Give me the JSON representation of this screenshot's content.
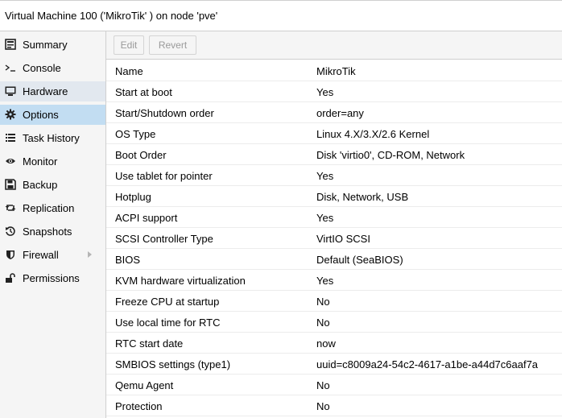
{
  "window": {
    "title": "Virtual Machine 100 ('MikroTik' ) on node 'pve'"
  },
  "sidebar": {
    "items": [
      {
        "label": "Summary",
        "icon": "summary-icon"
      },
      {
        "label": "Console",
        "icon": "console-icon"
      },
      {
        "label": "Hardware",
        "icon": "monitor-icon",
        "state": "hover"
      },
      {
        "label": "Options",
        "icon": "gear-icon",
        "state": "selected"
      },
      {
        "label": "Task History",
        "icon": "list-icon"
      },
      {
        "label": "Monitor",
        "icon": "eye-icon"
      },
      {
        "label": "Backup",
        "icon": "floppy-icon"
      },
      {
        "label": "Replication",
        "icon": "retweet-icon"
      },
      {
        "label": "Snapshots",
        "icon": "history-icon"
      },
      {
        "label": "Firewall",
        "icon": "shield-icon",
        "has_submenu": true
      },
      {
        "label": "Permissions",
        "icon": "unlock-icon"
      }
    ]
  },
  "toolbar": {
    "edit_label": "Edit",
    "revert_label": "Revert"
  },
  "options": [
    {
      "key": "Name",
      "value": "MikroTik"
    },
    {
      "key": "Start at boot",
      "value": "Yes"
    },
    {
      "key": "Start/Shutdown order",
      "value": "order=any"
    },
    {
      "key": "OS Type",
      "value": "Linux 4.X/3.X/2.6 Kernel"
    },
    {
      "key": "Boot Order",
      "value": "Disk 'virtio0', CD-ROM, Network"
    },
    {
      "key": "Use tablet for pointer",
      "value": "Yes"
    },
    {
      "key": "Hotplug",
      "value": "Disk, Network, USB"
    },
    {
      "key": "ACPI support",
      "value": "Yes"
    },
    {
      "key": "SCSI Controller Type",
      "value": "VirtIO SCSI"
    },
    {
      "key": "BIOS",
      "value": "Default (SeaBIOS)"
    },
    {
      "key": "KVM hardware virtualization",
      "value": "Yes"
    },
    {
      "key": "Freeze CPU at startup",
      "value": "No"
    },
    {
      "key": "Use local time for RTC",
      "value": "No"
    },
    {
      "key": "RTC start date",
      "value": "now"
    },
    {
      "key": "SMBIOS settings (type1)",
      "value": "uuid=c8009a24-54c2-4617-a1be-a44d7c6aaf7a"
    },
    {
      "key": "Qemu Agent",
      "value": "No"
    },
    {
      "key": "Protection",
      "value": "No"
    }
  ],
  "colors": {
    "selected_bg": "#c2ddf2",
    "hover_bg": "#e2e8ef",
    "sidebar_bg": "#f5f5f5"
  }
}
